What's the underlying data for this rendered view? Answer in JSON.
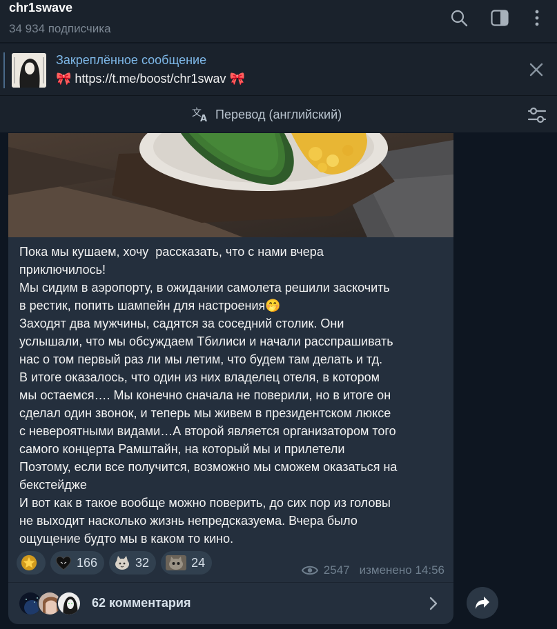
{
  "header": {
    "channel_name": "chr1swave",
    "subscribers": "34 934 подписчика"
  },
  "pinned": {
    "title": "Закреплённое сообщение",
    "text": "🎀 https://t.me/boost/chr1swav 🎀"
  },
  "translate": {
    "label": "Перевод (английский)"
  },
  "post": {
    "text": "Пока мы кушаем, хочу  рассказать, что с нами вчера\nприключилось!\nМы сидим в аэропорту, в ожидании самолета решили заскочить\nв рестик, попить шампейн для настроения🤭\nЗаходят два мужчины, садятся за соседний столик. Они\nуслышали, что мы обсуждаем Тбилиси и начали расспрашивать\nнас о том первый раз ли мы летим, что будем там делать и тд.\nВ итоге оказалось, что один из них владелец отеля, в котором\nмы остаемся…. Мы конечно сначала не поверили, но в итоге он\nсделал один звонок, и теперь мы живем в президентском люксе\nс невероятными видами…А второй является организатором того\nсамого концерта Рамштайн, на который мы и прилетели\nПоэтому, если все получится, возможно мы сможем оказаться на\nбекстейдже\nИ вот как в такое вообще можно поверить, до сих пор из головы\nне выходит насколько жизнь непредсказуема. Вчера было\nощущение будто мы в каком то кино.",
    "reactions": [
      {
        "icon": "star",
        "count": ""
      },
      {
        "icon": "black-heart",
        "count": "166"
      },
      {
        "icon": "cat-sticker",
        "count": "32"
      },
      {
        "icon": "cat-photo-sticker",
        "count": "24"
      }
    ],
    "views": "2547",
    "edited": "изменено 14:56"
  },
  "comments": {
    "label": "62 комментария"
  },
  "colors": {
    "background": "#0e1621",
    "header_bg": "#1a222c",
    "bubble_bg": "#242f3d",
    "accent": "#7eb8e8",
    "muted": "#7c8793"
  }
}
